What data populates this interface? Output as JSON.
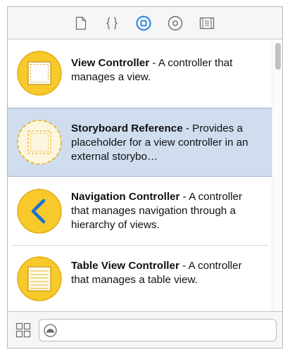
{
  "toolbar": {
    "tabs": [
      {
        "icon": "file-icon"
      },
      {
        "icon": "braces-icon"
      },
      {
        "icon": "object-library-icon",
        "selected": true
      },
      {
        "icon": "media-library-icon"
      },
      {
        "icon": "snippet-library-icon"
      }
    ],
    "accent_color": "#1a82e6"
  },
  "library": {
    "items": [
      {
        "title": "View Controller",
        "description": " - A controller that manages a view.",
        "icon": "view-controller-icon"
      },
      {
        "title": "Storyboard Reference",
        "description": " - Provides a placeholder for a view controller in an external storybo…",
        "icon": "storyboard-reference-icon",
        "selected": true
      },
      {
        "title": "Navigation Controller",
        "description": " - A controller that manages navigation through a hierarchy of views.",
        "icon": "navigation-controller-icon"
      },
      {
        "title": "Table View Controller",
        "description": " - A controller that manages a table view.",
        "icon": "table-view-controller-icon"
      }
    ]
  },
  "bottom": {
    "filter_placeholder": ""
  },
  "colors": {
    "icon_yellow": "#f7c92b",
    "icon_yellow_border": "#e2ad13",
    "selected_row": "#cfddef"
  }
}
